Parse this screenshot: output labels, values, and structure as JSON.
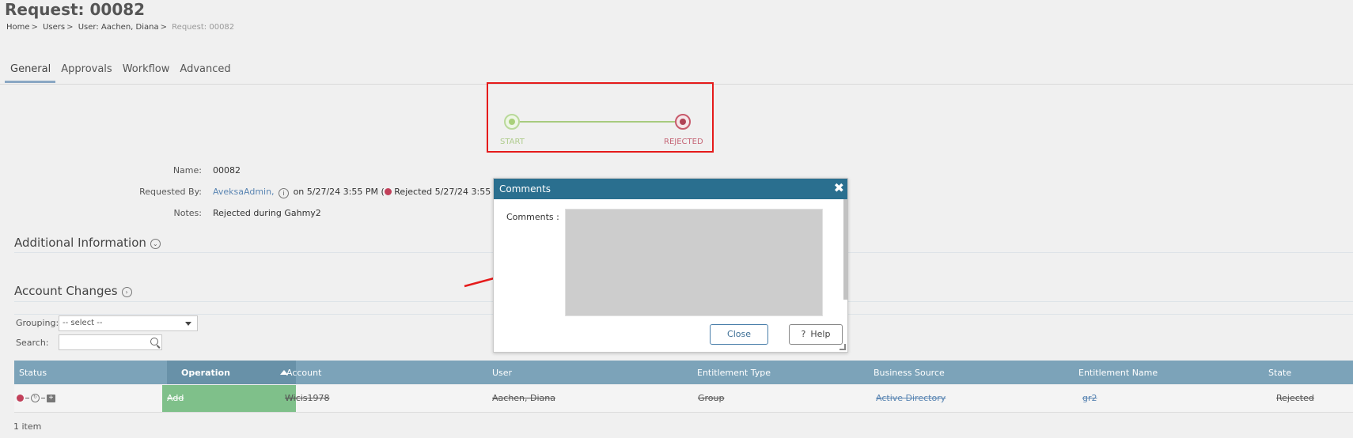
{
  "page": {
    "title": "Request: 00082"
  },
  "breadcrumb": {
    "items": [
      "Home",
      "Users",
      "User: Aachen, Diana"
    ],
    "current": "Request: 00082"
  },
  "tabs": [
    {
      "label": "General",
      "active": true
    },
    {
      "label": "Approvals",
      "active": false
    },
    {
      "label": "Workflow",
      "active": false
    },
    {
      "label": "Advanced",
      "active": false
    }
  ],
  "workflow": {
    "start_label": "START",
    "end_label": "REJECTED",
    "start_color": "#a9d07a",
    "end_color": "#b04356"
  },
  "details": {
    "name_label": "Name:",
    "name_value": "00082",
    "requested_by_label": "Requested By:",
    "requested_by_user": "AveksaAdmin,",
    "requested_on": "on 5/27/24 3:55 PM (",
    "rejected_text": "Rejected 5/27/24 3:55 PM)",
    "notes_label": "Notes:",
    "notes_value": "Rejected during Gahmy2"
  },
  "sections": {
    "additional_info": "Additional Information",
    "account_changes": "Account Changes"
  },
  "filters": {
    "grouping_label": "Grouping:",
    "grouping_value": "-- select --",
    "search_label": "Search:"
  },
  "table": {
    "headers": [
      "Status",
      "Operation",
      "Account",
      "User",
      "Entitlement Type",
      "Business Source",
      "Entitlement Name",
      "State"
    ],
    "rows": [
      {
        "operation": "Add",
        "account": "Wicis1978",
        "user": "Aachen, Diana",
        "entitlement_type": "Group",
        "business_source": "Active Directory",
        "entitlement_name": "gr2",
        "state": "Rejected"
      }
    ],
    "item_count": "1 item"
  },
  "dialog": {
    "title": "Comments",
    "comments_label": "Comments :",
    "close_label": "Close",
    "help_label": "Help",
    "help_icon": "?"
  },
  "colors": {
    "header_bg": "#7ca3b9",
    "dialog_title_bg": "#2a6f8f",
    "annotation_red": "#e51b1b",
    "operation_green": "#7fc08a"
  }
}
